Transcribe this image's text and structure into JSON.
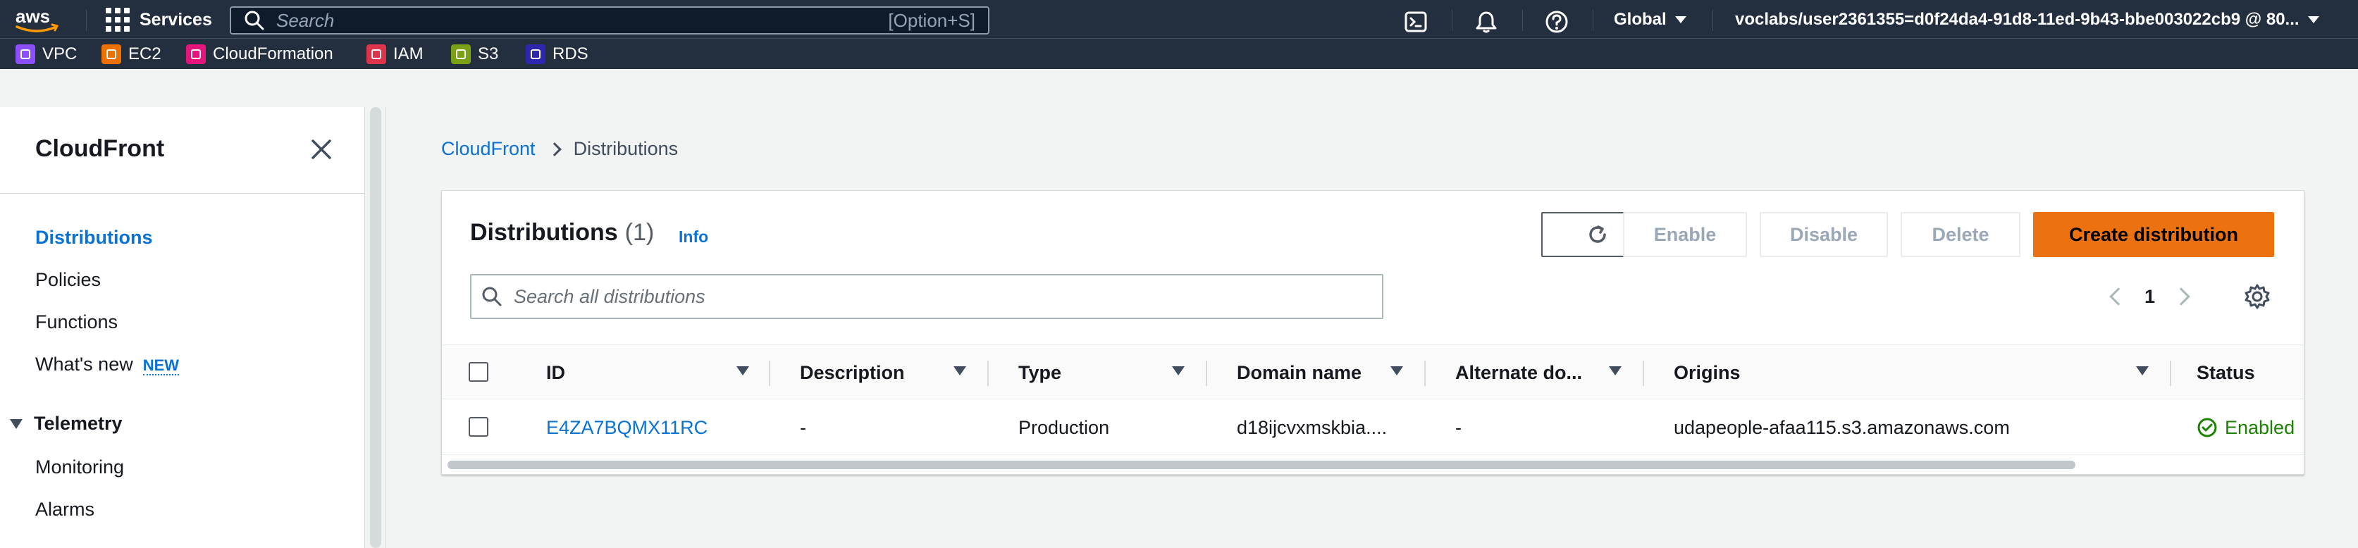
{
  "topnav": {
    "logo": "aws",
    "services_label": "Services",
    "search_placeholder": "Search",
    "search_shortcut": "[Option+S]",
    "region_label": "Global",
    "account_label": "voclabs/user2361355=d0f24da4-91d8-11ed-9b43-bbe003022cb9 @ 80...",
    "icons": [
      "cloudshell-icon",
      "notifications-icon",
      "help-icon"
    ],
    "favorites": [
      {
        "label": "VPC",
        "color": "#8c4fff"
      },
      {
        "label": "EC2",
        "color": "#ed7100"
      },
      {
        "label": "CloudFormation",
        "color": "#e7157b"
      },
      {
        "label": "IAM",
        "color": "#dd344c"
      },
      {
        "label": "S3",
        "color": "#7aa116"
      },
      {
        "label": "RDS",
        "color": "#2e27ad"
      }
    ]
  },
  "sidenav": {
    "title": "CloudFront",
    "items": [
      {
        "label": "Distributions",
        "active": true
      },
      {
        "label": "Policies"
      },
      {
        "label": "Functions"
      },
      {
        "label": "What's new",
        "badge": "NEW"
      }
    ],
    "section": {
      "label": "Telemetry",
      "items": [
        {
          "label": "Monitoring"
        },
        {
          "label": "Alarms"
        }
      ]
    }
  },
  "breadcrumb": {
    "root": "CloudFront",
    "current": "Distributions"
  },
  "distributions": {
    "title": "Distributions",
    "count": "(1)",
    "info": "Info",
    "buttons": {
      "enable": "Enable",
      "disable": "Disable",
      "delete": "Delete",
      "create": "Create distribution"
    },
    "search_placeholder": "Search all distributions",
    "page": "1",
    "columns": [
      "ID",
      "Description",
      "Type",
      "Domain name",
      "Alternate do...",
      "Origins",
      "Status"
    ],
    "rows": [
      {
        "id": "E4ZA7BQMX11RC",
        "description": "-",
        "type": "Production",
        "domain": "d18ijcvxmskbia....",
        "alternate": "-",
        "origins": "udapeople-afaa115.s3.amazonaws.com",
        "status": "Enabled"
      }
    ]
  },
  "colors": {
    "nav_bg": "#232f3e",
    "link": "#0972d3",
    "primary_button": "#ec7211",
    "status_ok": "#1d8102"
  }
}
